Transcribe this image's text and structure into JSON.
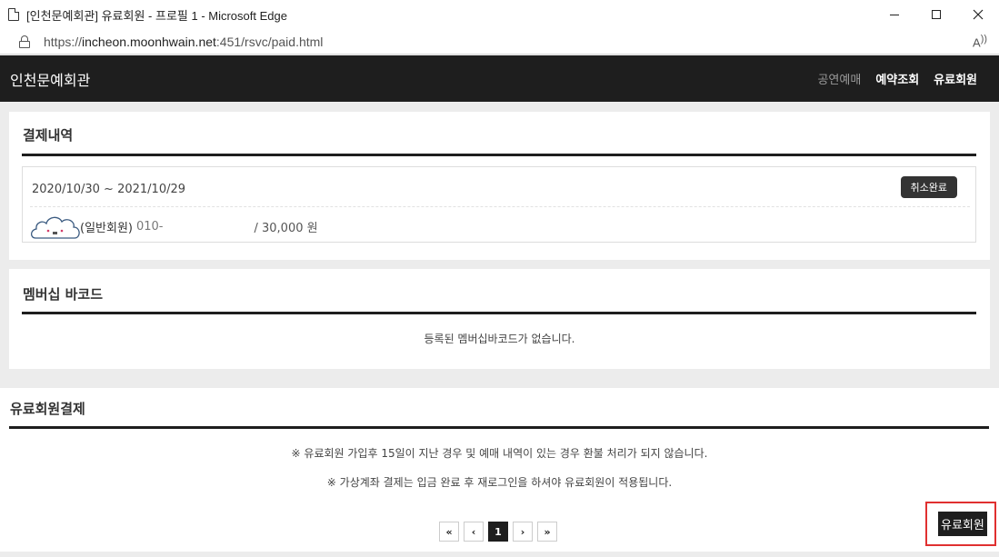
{
  "window": {
    "title": "[인천문예회관] 유료회원 - 프로필 1 - Microsoft Edge",
    "url_scheme": "https://",
    "url_host": "incheon.moonhwain.net",
    "url_rest": ":451/rsvc/paid.html",
    "read_aloud": "A"
  },
  "header": {
    "logo": "인천문예회관",
    "nav": [
      "공연예매",
      "예약조회",
      "유료회원"
    ]
  },
  "payment": {
    "title": "결제내역",
    "period": "2020/10/30 ~ 2021/10/29",
    "status": "취소완료",
    "member_type": "(일반회원)",
    "phone": "010-",
    "amount": "/ 30,000 원"
  },
  "barcode": {
    "title": "멤버십 바코드",
    "empty_message": "등록된 멤버십바코드가 없습니다."
  },
  "paid_join": {
    "title": "유료회원결제",
    "notice1": "※ 유료회원 가입후 15일이 지난 경우 및 예매 내역이 있는 경우 환불 처리가 되지 않습니다.",
    "notice2": "※ 가상계좌 결제는 입금 완료 후 재로그인을 하셔야 유료회원이 적용됩니다.",
    "pagination": {
      "first": "«",
      "prev": "‹",
      "current": "1",
      "next": "›",
      "last": "»"
    },
    "join_button": "유료회원"
  },
  "colors": {
    "header_bg": "#1e1e1e",
    "highlight": "#e03030"
  }
}
